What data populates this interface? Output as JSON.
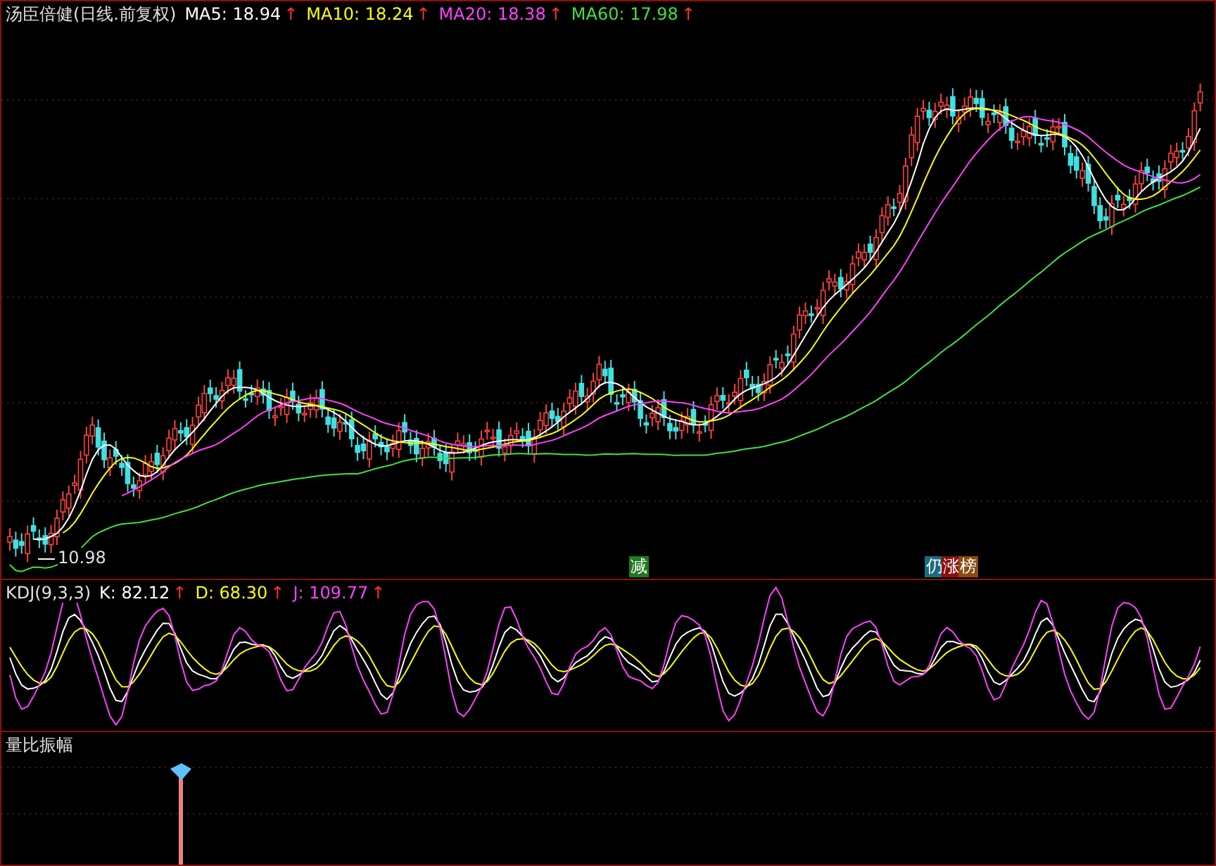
{
  "main": {
    "title": "汤臣倍健(日线.前复权)",
    "indicators": [
      {
        "label": "MA5: 18.94",
        "trend": "↑",
        "color": "#ffffff"
      },
      {
        "label": "MA10: 18.24",
        "trend": "↑",
        "color": "#ffff00"
      },
      {
        "label": "MA20: 18.38",
        "trend": "↑",
        "color": "#ff40ff"
      },
      {
        "label": "MA60: 17.98",
        "trend": "↑",
        "color": "#40e040"
      }
    ],
    "low_label": "10.98",
    "badges": [
      {
        "text": "减",
        "color": "#1e7a1e"
      },
      {
        "text": "仍",
        "color": "#1c6c80"
      },
      {
        "text": "涨",
        "color": "#8a1010"
      },
      {
        "text": "榜",
        "color": "#8a4a10"
      }
    ]
  },
  "kdj": {
    "title": "KDJ(9,3,3)",
    "indicators": [
      {
        "label": "K: 82.12",
        "trend": "↑",
        "color": "#ffffff"
      },
      {
        "label": "D: 68.30",
        "trend": "↑",
        "color": "#ffff00"
      },
      {
        "label": "J: 109.77",
        "trend": "↑",
        "color": "#ff40ff"
      }
    ]
  },
  "volume": {
    "title": "量比振幅"
  }
}
